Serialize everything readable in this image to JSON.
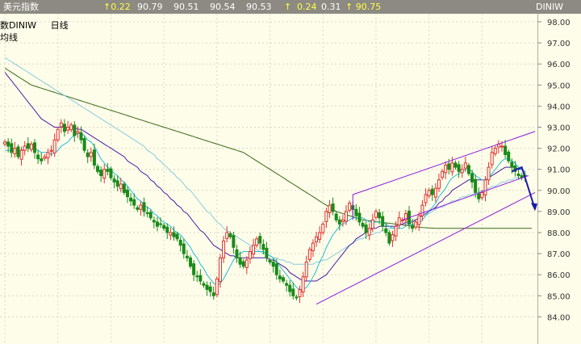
{
  "header": {
    "title": "美元指数",
    "q1": "↑0.22",
    "q2": "90.79",
    "q3": "90.51",
    "q4": "90.54",
    "q5": "90.53",
    "q6": "↑",
    "q7": "0.24",
    "q8": "0.31",
    "q9": "↑ 90.75",
    "symbol": "DINIW"
  },
  "legend": {
    "symbol": "数DINIW",
    "period": "日线",
    "sub": "均线"
  },
  "colors": {
    "background": "#fefde9",
    "grid": "#d8d8c8",
    "candle_up": "#e03030",
    "candle_down": "#1a8a1a",
    "ma_short": "#22bbdd",
    "ma_mid": "#4a1aa8",
    "ma_mid2": "#88cce0",
    "ma_long": "#3a6a1a",
    "channel": "#8a1ae0",
    "arrow": "#1a1aaa"
  },
  "chart_data": {
    "type": "candlestick",
    "ylim": [
      83.5,
      98.3
    ],
    "y_ticks": [
      "98.00",
      "97.00",
      "96.00",
      "95.00",
      "94.00",
      "93.00",
      "92.00",
      "91.00",
      "90.00",
      "89.00",
      "88.00",
      "87.00",
      "86.00",
      "85.00",
      "84.00"
    ],
    "grid": true,
    "bars_visible": 160,
    "close": [
      92.3,
      92.1,
      91.8,
      92.0,
      91.6,
      91.9,
      92.1,
      92.0,
      92.2,
      91.8,
      91.5,
      91.4,
      91.6,
      91.8,
      91.9,
      92.4,
      92.9,
      93.2,
      92.8,
      93.0,
      93.1,
      92.6,
      92.8,
      92.4,
      91.9,
      91.6,
      91.8,
      91.2,
      90.9,
      90.7,
      91.0,
      90.9,
      90.6,
      90.4,
      90.2,
      90.3,
      89.9,
      89.7,
      89.5,
      89.3,
      89.1,
      89.3,
      89.0,
      88.9,
      88.7,
      88.5,
      88.3,
      88.4,
      88.2,
      88.0,
      88.0,
      87.8,
      87.7,
      87.4,
      87.0,
      86.8,
      86.4,
      86.0,
      85.9,
      85.7,
      85.5,
      85.3,
      85.2,
      85.0,
      85.8,
      86.8,
      87.6,
      88.0,
      87.8,
      87.3,
      86.8,
      86.5,
      86.4,
      86.7,
      87.1,
      87.4,
      87.7,
      87.5,
      87.2,
      86.8,
      86.6,
      86.4,
      86.0,
      85.8,
      85.7,
      85.5,
      85.2,
      85.0,
      84.9,
      85.3,
      85.9,
      86.6,
      87.2,
      87.5,
      87.8,
      88.0,
      88.4,
      89.0,
      89.3,
      89.0,
      88.6,
      88.4,
      88.6,
      89.0,
      89.4,
      89.1,
      88.8,
      88.5,
      88.3,
      88.0,
      88.2,
      88.6,
      89.0,
      88.7,
      88.3,
      88.0,
      87.5,
      87.9,
      88.3,
      88.7,
      88.6,
      88.9,
      88.4,
      88.2,
      88.5,
      88.8,
      89.3,
      89.8,
      90.0,
      89.8,
      90.1,
      90.5,
      90.9,
      91.2,
      91.0,
      91.3,
      91.1,
      90.9,
      91.0,
      91.3,
      90.8,
      90.4,
      89.9,
      89.6,
      89.9,
      90.5,
      91.1,
      91.8,
      92.0,
      92.2,
      92.1,
      91.7,
      91.4,
      91.1,
      90.9,
      90.7,
      90.6,
      90.7
    ],
    "ma_short": [
      91.9,
      91.9,
      91.9,
      91.9,
      91.9,
      91.9,
      92.0,
      92.0,
      92.0,
      92.0,
      91.9,
      91.8,
      91.8,
      91.8,
      91.7,
      91.8,
      91.9,
      92.1,
      92.2,
      92.3,
      92.5,
      92.6,
      92.7,
      92.7,
      92.6,
      92.4,
      92.3,
      92.1,
      91.8,
      91.5,
      91.3,
      91.1,
      91.0,
      90.8,
      90.7,
      90.5,
      90.4,
      90.2,
      90.0,
      89.8,
      89.6,
      89.5,
      89.3,
      89.2,
      89.1,
      88.9,
      88.8,
      88.6,
      88.5,
      88.4,
      88.3,
      88.1,
      88.0,
      87.9,
      87.7,
      87.5,
      87.3,
      87.0,
      86.8,
      86.5,
      86.3,
      86.0,
      85.8,
      85.6,
      85.5,
      85.6,
      85.8,
      86.1,
      86.4,
      86.7,
      86.9,
      87.0,
      87.1,
      87.1,
      87.1,
      87.1,
      87.1,
      87.1,
      87.1,
      87.0,
      86.9,
      86.8,
      86.6,
      86.4,
      86.2,
      86.0,
      85.8,
      85.6,
      85.4,
      85.3,
      85.3,
      85.4,
      85.6,
      85.9,
      86.2,
      86.6,
      86.9,
      87.3,
      87.6,
      87.9,
      88.1,
      88.3,
      88.4,
      88.5,
      88.6,
      88.7,
      88.7,
      88.7,
      88.7,
      88.6,
      88.5,
      88.5,
      88.5,
      88.5,
      88.5,
      88.4,
      88.3,
      88.2,
      88.2,
      88.2,
      88.2,
      88.3,
      88.4,
      88.4,
      88.4,
      88.4,
      88.6,
      88.8,
      89.0,
      89.2,
      89.4,
      89.7,
      89.9,
      90.1,
      90.4,
      90.6,
      90.7,
      90.8,
      90.9,
      91.0,
      91.0,
      90.9,
      90.7,
      90.6,
      90.5,
      90.5,
      90.6,
      90.8,
      91.0,
      91.2,
      91.4,
      91.5,
      91.5,
      91.4,
      91.3,
      91.1,
      91.0,
      90.9
    ],
    "ma_mid": [
      95.6,
      95.4,
      95.2,
      95.0,
      94.8,
      94.6,
      94.4,
      94.2,
      94.0,
      93.8,
      93.6,
      93.4,
      93.3,
      93.2,
      93.1,
      93.0,
      93.0,
      93.0,
      93.0,
      93.0,
      93.0,
      93.0,
      92.9,
      92.9,
      92.8,
      92.7,
      92.6,
      92.5,
      92.4,
      92.3,
      92.2,
      92.1,
      92.0,
      91.9,
      91.8,
      91.7,
      91.6,
      91.4,
      91.3,
      91.2,
      91.1,
      90.9,
      90.8,
      90.7,
      90.5,
      90.4,
      90.2,
      90.1,
      89.9,
      89.8,
      89.6,
      89.5,
      89.3,
      89.2,
      89.0,
      88.9,
      88.7,
      88.5,
      88.3,
      88.1,
      88.0,
      87.8,
      87.6,
      87.4,
      87.3,
      87.2,
      87.1,
      87.0,
      86.9,
      86.9,
      86.8,
      86.8,
      86.8,
      86.8,
      86.8,
      86.8,
      86.8,
      86.8,
      86.8,
      86.8,
      86.7,
      86.7,
      86.6,
      86.5,
      86.4,
      86.3,
      86.1,
      86.0,
      85.9,
      85.8,
      85.7,
      85.7,
      85.7,
      85.7,
      85.7,
      85.8,
      85.9,
      86.0,
      86.2,
      86.4,
      86.6,
      86.8,
      87.0,
      87.2,
      87.4,
      87.5,
      87.7,
      87.8,
      87.9,
      88.0,
      88.1,
      88.2,
      88.2,
      88.3,
      88.3,
      88.3,
      88.3,
      88.3,
      88.3,
      88.4,
      88.4,
      88.5,
      88.5,
      88.5,
      88.6,
      88.7,
      88.8,
      88.9,
      89.0,
      89.1,
      89.2,
      89.4,
      89.5,
      89.7,
      89.8,
      90.0,
      90.1,
      90.2,
      90.3,
      90.4,
      90.5,
      90.5,
      90.5,
      90.5,
      90.5,
      90.5,
      90.6,
      90.7,
      90.8,
      90.9,
      91.0,
      91.1,
      91.1,
      91.1,
      91.1,
      91.0,
      91.0,
      90.9
    ],
    "ma_mid2": [
      96.3,
      96.2,
      96.1,
      96.0,
      95.9,
      95.8,
      95.7,
      95.6,
      95.5,
      95.4,
      95.3,
      95.2,
      95.1,
      95.0,
      94.9,
      94.8,
      94.7,
      94.6,
      94.5,
      94.4,
      94.3,
      94.2,
      94.1,
      94.0,
      93.9,
      93.8,
      93.7,
      93.6,
      93.5,
      93.4,
      93.3,
      93.2,
      93.1,
      93.0,
      92.9,
      92.8,
      92.7,
      92.6,
      92.5,
      92.4,
      92.3,
      92.2,
      92.1,
      91.9,
      91.8,
      91.7,
      91.5,
      91.4,
      91.2,
      91.1,
      90.9,
      90.8,
      90.6,
      90.5,
      90.3,
      90.1,
      90.0,
      89.8,
      89.6,
      89.4,
      89.2,
      89.0,
      88.9,
      88.7,
      88.5,
      88.4,
      88.2,
      88.1,
      88.0,
      87.9,
      87.8,
      87.7,
      87.6,
      87.5,
      87.4,
      87.3,
      87.2,
      87.1,
      87.0,
      87.0,
      86.9,
      86.8,
      86.8,
      86.7,
      86.7,
      86.6,
      86.6,
      86.5,
      86.5,
      86.5,
      86.5,
      86.5,
      86.5,
      86.5,
      86.6,
      86.6,
      86.7,
      86.7,
      86.8,
      86.9,
      87.0,
      87.1,
      87.2,
      87.3,
      87.4,
      87.5,
      87.6,
      87.7,
      87.7,
      87.8,
      87.9,
      87.9,
      88.0,
      88.0,
      88.1,
      88.1,
      88.2,
      88.2,
      88.3,
      88.3,
      88.4,
      88.4,
      88.5,
      88.6,
      88.6,
      88.7,
      88.8,
      88.8,
      88.9,
      89.0,
      89.1,
      89.2,
      89.2,
      89.3,
      89.4,
      89.5,
      89.5,
      89.6,
      89.7,
      89.7,
      89.8,
      89.8,
      89.9,
      89.9,
      90.0,
      90.0,
      90.1,
      90.2,
      90.2,
      90.3,
      90.4,
      90.4,
      90.5,
      90.5,
      90.6,
      90.6,
      90.6,
      90.7
    ],
    "ma_long": [
      95.8,
      95.7,
      95.6,
      95.5,
      95.4,
      95.3,
      95.2,
      95.1,
      95.0,
      94.95,
      94.9,
      94.85,
      94.8,
      94.75,
      94.7,
      94.65,
      94.6,
      94.55,
      94.5,
      94.45,
      94.4,
      94.35,
      94.3,
      94.25,
      94.2,
      94.15,
      94.1,
      94.05,
      94.0,
      93.95,
      93.9,
      93.85,
      93.8,
      93.75,
      93.7,
      93.65,
      93.6,
      93.55,
      93.5,
      93.45,
      93.4,
      93.35,
      93.3,
      93.25,
      93.2,
      93.15,
      93.1,
      93.05,
      93.0,
      92.95,
      92.9,
      92.85,
      92.8,
      92.75,
      92.7,
      92.65,
      92.6,
      92.55,
      92.5,
      92.45,
      92.4,
      92.35,
      92.3,
      92.25,
      92.2,
      92.15,
      92.1,
      92.05,
      92.0,
      91.95,
      91.9,
      91.85,
      91.8,
      91.7,
      91.6,
      91.5,
      91.4,
      91.3,
      91.2,
      91.1,
      91.0,
      90.9,
      90.8,
      90.7,
      90.6,
      90.5,
      90.4,
      90.3,
      90.2,
      90.1,
      90.0,
      89.9,
      89.8,
      89.7,
      89.6,
      89.5,
      89.4,
      89.3,
      89.2,
      89.1,
      89.0,
      88.95,
      88.9,
      88.85,
      88.8,
      88.75,
      88.7,
      88.65,
      88.6,
      88.58,
      88.56,
      88.54,
      88.52,
      88.5,
      88.48,
      88.46,
      88.44,
      88.42,
      88.4,
      88.38,
      88.36,
      88.34,
      88.32,
      88.3,
      88.28,
      88.26,
      88.24,
      88.23,
      88.22,
      88.21,
      88.2,
      88.2,
      88.2,
      88.2,
      88.2,
      88.2,
      88.2,
      88.2,
      88.2,
      88.2,
      88.2,
      88.2,
      88.2,
      88.2,
      88.2,
      88.2,
      88.2,
      88.2,
      88.2,
      88.2,
      88.2,
      88.2,
      88.2,
      88.2,
      88.2,
      88.2,
      88.2,
      88.2,
      88.2,
      88.2
    ],
    "channel_upper": {
      "from_bar": 105,
      "to_bar": 160,
      "from": 89.8,
      "to": 92.8
    },
    "channel_lower": {
      "from_bar": 94,
      "to_bar": 160,
      "from": 84.6,
      "to": 89.9
    },
    "channel_mid": {
      "from_bar": 120,
      "to_bar": 158,
      "from": 88.6,
      "to": 90.7
    },
    "arrow": [
      {
        "bar": 153,
        "value": 90.9
      },
      {
        "bar": 156,
        "value": 91.1
      },
      {
        "bar": 160,
        "value": 89.1
      }
    ]
  }
}
